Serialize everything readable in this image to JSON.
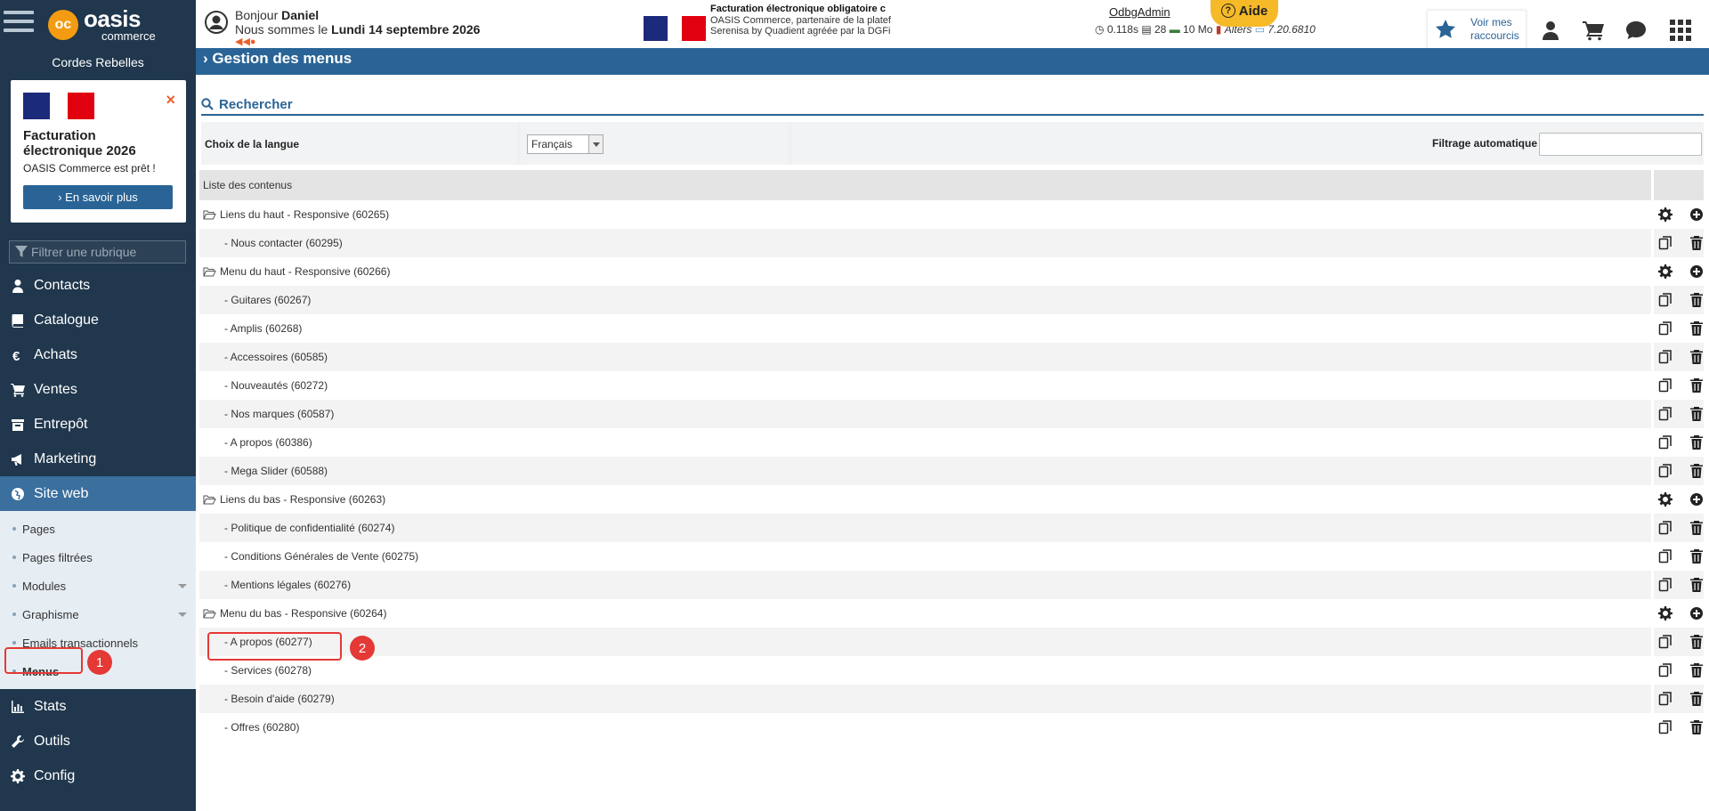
{
  "sidebar": {
    "brand_name": "oasis",
    "brand_sub": "commerce",
    "company": "Cordes Rebelles",
    "promo": {
      "title": "Facturation électronique 2026",
      "subtitle": "OASIS Commerce est prêt !",
      "button": "› En savoir plus"
    },
    "filter_placeholder": "Filtrer une rubrique",
    "nav": [
      {
        "label": "Contacts",
        "icon": "user-icon"
      },
      {
        "label": "Catalogue",
        "icon": "book-icon"
      },
      {
        "label": "Achats",
        "icon": "euro-icon"
      },
      {
        "label": "Ventes",
        "icon": "cart-icon"
      },
      {
        "label": "Entrepôt",
        "icon": "warehouse-icon"
      },
      {
        "label": "Marketing",
        "icon": "megaphone-icon"
      },
      {
        "label": "Site web",
        "icon": "globe-icon"
      }
    ],
    "submenu": [
      {
        "label": "Pages"
      },
      {
        "label": "Pages filtrées"
      },
      {
        "label": "Modules"
      },
      {
        "label": "Graphisme"
      },
      {
        "label": "Emails transactionnels"
      },
      {
        "label": "Menus"
      }
    ],
    "nav_bottom": [
      {
        "label": "Stats",
        "icon": "chart-icon"
      },
      {
        "label": "Outils",
        "icon": "wrench-icon"
      },
      {
        "label": "Config",
        "icon": "gear-icon"
      }
    ]
  },
  "topbar": {
    "greeting_prefix": "Bonjour",
    "user": "Daniel",
    "date_prefix": "Nous sommes le",
    "date": "Lundi 14 septembre 2026",
    "fe_line1": "Facturation électronique obligatoire c",
    "fe_line2": "OASIS Commerce, partenaire de la platef",
    "fe_line3": "Serenisa by Quadient agréée par la DGFi",
    "debug_user": "OdbgAdmin",
    "debug_time": "0.118s",
    "debug_queries": "28",
    "debug_mem": "10 Mo",
    "debug_alters": "Alters",
    "debug_version": "7.20.6810",
    "aide": "Aide",
    "shortcut_line1": "Voir mes",
    "shortcut_line2": "raccourcis"
  },
  "page": {
    "title": "Gestion des menus",
    "search_title": "Rechercher",
    "lang_label": "Choix de la langue",
    "lang_value": "Français",
    "filter_label": "Filtrage automatique :",
    "list_header": "Liste des contenus"
  },
  "rows": [
    {
      "label": "Liens du haut - Responsive (60265)",
      "type": "parent"
    },
    {
      "label": "- Nous contacter (60295)",
      "type": "child"
    },
    {
      "label": "Menu du haut - Responsive (60266)",
      "type": "parent"
    },
    {
      "label": "- Guitares (60267)",
      "type": "child"
    },
    {
      "label": "- Amplis (60268)",
      "type": "child"
    },
    {
      "label": "- Accessoires (60585)",
      "type": "child"
    },
    {
      "label": "- Nouveautés (60272)",
      "type": "child"
    },
    {
      "label": "- Nos marques (60587)",
      "type": "child"
    },
    {
      "label": "- A propos (60386)",
      "type": "child"
    },
    {
      "label": "- Mega Slider (60588)",
      "type": "child"
    },
    {
      "label": "Liens du bas - Responsive (60263)",
      "type": "parent"
    },
    {
      "label": "- Politique de confidentialité (60274)",
      "type": "child"
    },
    {
      "label": "- Conditions Générales de Vente (60275)",
      "type": "child"
    },
    {
      "label": "- Mentions légales (60276)",
      "type": "child"
    },
    {
      "label": "Menu du bas - Responsive (60264)",
      "type": "parent"
    },
    {
      "label": "- A propos (60277)",
      "type": "child"
    },
    {
      "label": "- Services (60278)",
      "type": "child"
    },
    {
      "label": "- Besoin d'aide (60279)",
      "type": "child"
    },
    {
      "label": "- Offres (60280)",
      "type": "child"
    }
  ],
  "annotations": {
    "badge1": "1",
    "badge2": "2"
  },
  "colors": {
    "sidebar": "#20374d",
    "accent": "#2a6496",
    "highlight": "#e53935",
    "aide": "#f6b928"
  }
}
